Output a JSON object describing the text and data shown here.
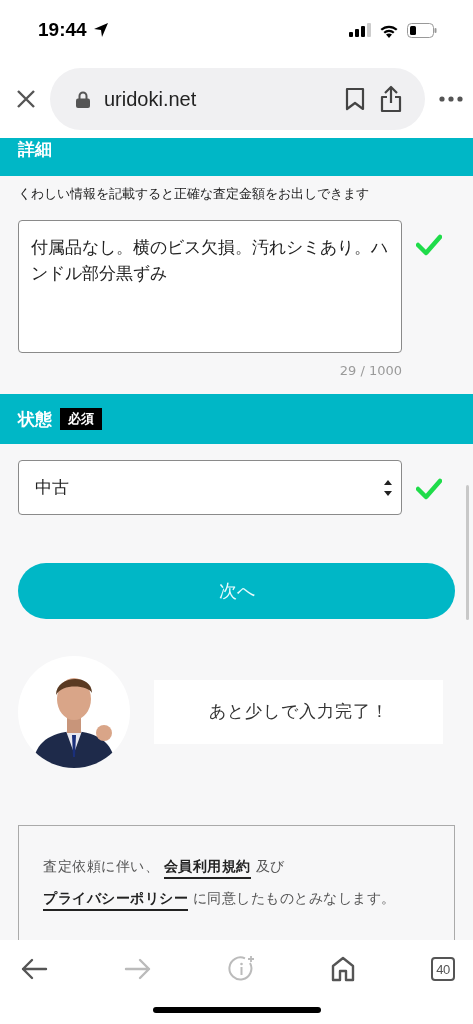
{
  "status_bar": {
    "time": "19:44"
  },
  "browser": {
    "url": "uridoki.net"
  },
  "details": {
    "heading": "詳細",
    "hint": "くわしい情報を記載すると正確な査定金額をお出しできます",
    "value": "付属品なし。横のビス欠損。汚れシミあり。ハンドル部分黒ずみ",
    "valid": true,
    "counter": "29 / 1000"
  },
  "condition": {
    "heading": "状態",
    "badge": "必須",
    "value": "中古",
    "valid": true
  },
  "next_button": "次へ",
  "assistant": {
    "message": "あと少しで入力完了！"
  },
  "consent": {
    "parts": [
      {
        "kind": "text",
        "text": "査定依頼に伴い、 "
      },
      {
        "kind": "link",
        "text": "会員利用規約"
      },
      {
        "kind": "text",
        "text": " 及び "
      },
      {
        "kind": "link",
        "text": "プライバシーポリシー"
      },
      {
        "kind": "text",
        "text": " に同意したものとみなします。"
      }
    ]
  },
  "toolbar": {
    "buttons": [
      {
        "kind": "back",
        "disabled": false
      },
      {
        "kind": "forward",
        "disabled": true
      },
      {
        "kind": "info",
        "disabled": true
      },
      {
        "kind": "home",
        "disabled": false
      },
      {
        "kind": "tabs",
        "disabled": false,
        "label": "40"
      }
    ]
  }
}
